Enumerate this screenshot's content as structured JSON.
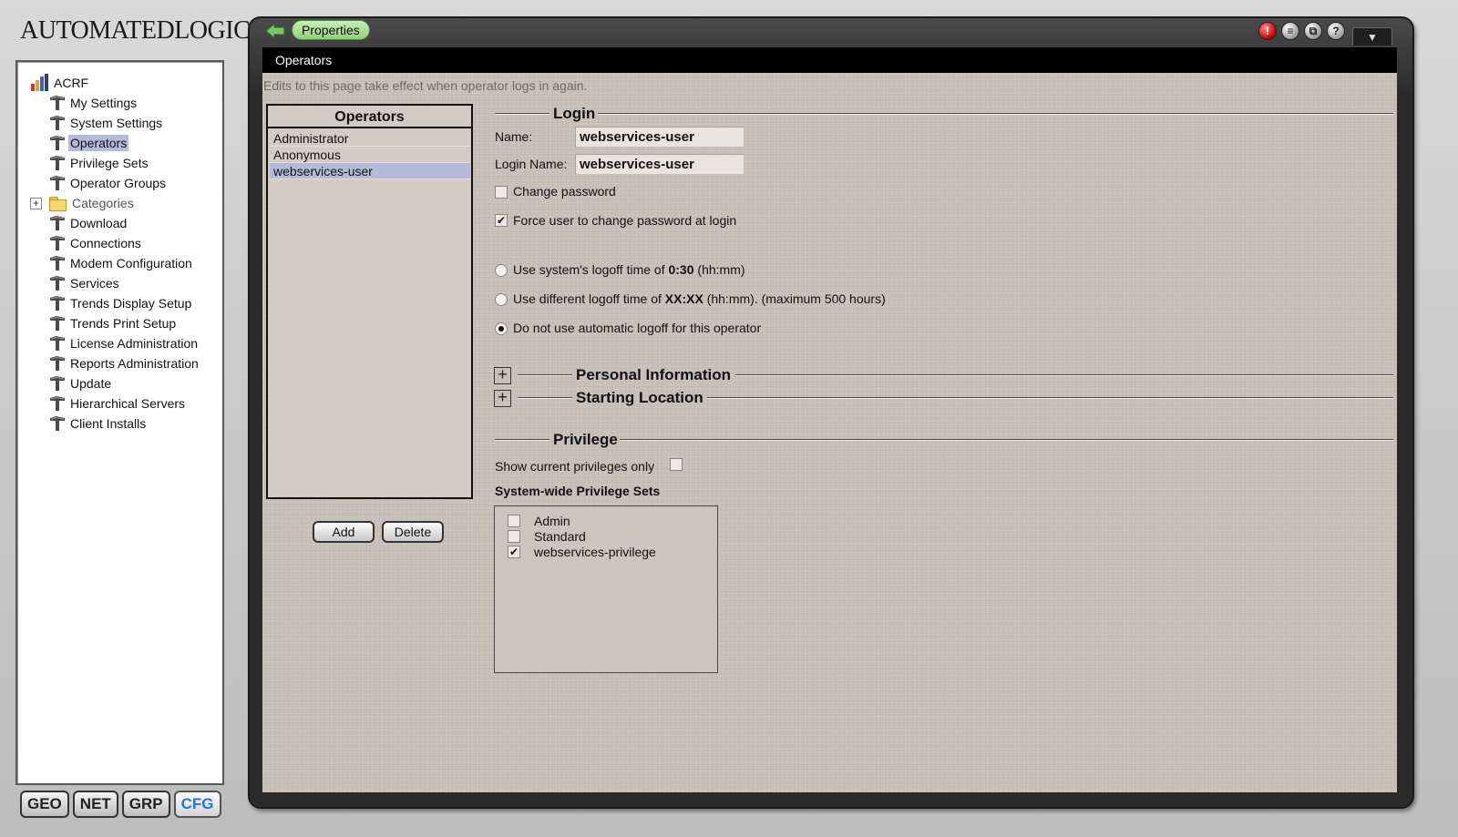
{
  "app": {
    "logo": "AUTOMATEDLOGIC",
    "logo_mark": "®"
  },
  "tree": {
    "root": "ACRF",
    "items": [
      {
        "label": "My Settings",
        "name": "my-settings"
      },
      {
        "label": "System Settings",
        "name": "system-settings"
      },
      {
        "label": "Operators",
        "name": "operators",
        "selected": true
      },
      {
        "label": "Privilege Sets",
        "name": "privilege-sets"
      },
      {
        "label": "Operator Groups",
        "name": "operator-groups"
      },
      {
        "label": "Categories",
        "name": "categories",
        "folder": true
      },
      {
        "label": "Download",
        "name": "download"
      },
      {
        "label": "Connections",
        "name": "connections"
      },
      {
        "label": "Modem Configuration",
        "name": "modem-configuration"
      },
      {
        "label": "Services",
        "name": "services"
      },
      {
        "label": "Trends Display Setup",
        "name": "trends-display-setup"
      },
      {
        "label": "Trends Print Setup",
        "name": "trends-print-setup"
      },
      {
        "label": "License Administration",
        "name": "license-administration"
      },
      {
        "label": "Reports Administration",
        "name": "reports-administration"
      },
      {
        "label": "Update",
        "name": "update"
      },
      {
        "label": "Hierarchical Servers",
        "name": "hierarchical-servers"
      },
      {
        "label": "Client Installs",
        "name": "client-installs"
      }
    ],
    "expander_symbol": "+"
  },
  "bottom_tabs": [
    "GEO",
    "NET",
    "GRP",
    "CFG"
  ],
  "toolbar": {
    "properties_label": "Properties",
    "alarm_symbol": "!",
    "print_symbol": "≡",
    "window_symbol": "⧉",
    "help_symbol": "?",
    "dropdown_symbol": "▼"
  },
  "page": {
    "title": "Operators",
    "notice": "Edits to this page take effect when operator logs in again."
  },
  "operators": {
    "header": "Operators",
    "list": [
      "Administrator",
      "Anonymous",
      "webservices-user"
    ],
    "selected_index": 2,
    "add_label": "Add",
    "delete_label": "Delete"
  },
  "login": {
    "title": "Login",
    "name_label": "Name:",
    "name_value": "webservices-user",
    "login_name_label": "Login Name:",
    "login_name_value": "webservices-user",
    "change_password_label": "Change password",
    "change_password_checked": false,
    "force_change_label": "Force user to change password at login",
    "force_change_checked": true,
    "logoff_options": [
      {
        "pre": "Use system's logoff time of ",
        "bold": "0:30",
        "post": " (hh:mm)",
        "selected": false
      },
      {
        "pre": "Use different logoff time of ",
        "bold": "XX:XX",
        "post": " (hh:mm).  (maximum 500 hours)",
        "selected": false
      },
      {
        "pre": "Do not use automatic logoff for this operator",
        "bold": "",
        "post": "",
        "selected": true
      }
    ],
    "check_symbol": "✔"
  },
  "sections": {
    "personal_info": "Personal Information",
    "starting_location": "Starting Location",
    "plus_symbol": "+"
  },
  "privilege": {
    "title": "Privilege",
    "show_current_label": "Show current privileges only",
    "show_current_checked": false,
    "system_wide_label": "System-wide Privilege Sets",
    "sets": [
      {
        "label": "Admin",
        "checked": false
      },
      {
        "label": "Standard",
        "checked": false
      },
      {
        "label": "webservices-privilege",
        "checked": true
      }
    ]
  },
  "colors": {
    "selection": "#b6bad9",
    "content_bg": "#c5bfb6",
    "properties_pill": "#a8e094",
    "active_tab": "#2a73d8",
    "alarm": "#c40000"
  }
}
